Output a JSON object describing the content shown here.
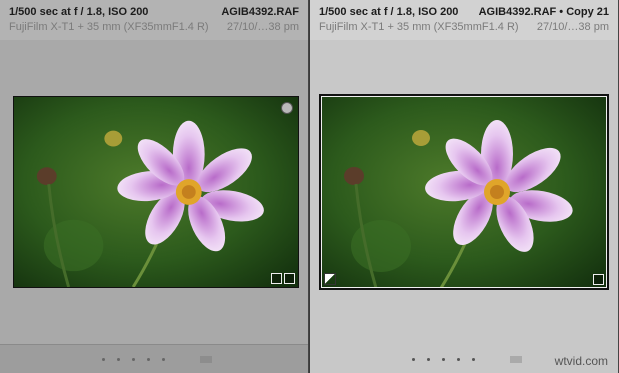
{
  "cells": [
    {
      "exposure": "1/500 sec at f / 1.8, ISO 200",
      "filename": "AGIB4392.RAF",
      "camera": "FujiFilm X-T1 + 35 mm (XF35mmF1.4 R)",
      "date": "27/10/…38 pm",
      "selected": false
    },
    {
      "exposure": "1/500 sec at f / 1.8, ISO 200",
      "filename": "AGIB4392.RAF  •  Copy 21",
      "camera": "FujiFilm X-T1 + 35 mm (XF35mmF1.4 R)",
      "date": "27/10/…38 pm",
      "selected": true
    }
  ],
  "icons": {
    "unpicked_flag": "circle-flag-icon",
    "virtual_copy": "virtual-copy-corner-icon",
    "crop_badge": "crop-badge-icon",
    "develop_badge": "develop-badge-icon",
    "rating_dots": "rating-dot-icon",
    "color_label": "color-label-icon"
  },
  "watermark": "wtvid.com"
}
